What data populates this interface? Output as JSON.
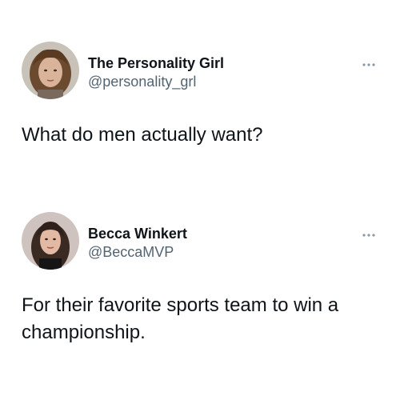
{
  "tweets": [
    {
      "display_name": "The Personality Girl",
      "handle": "@personality_grl",
      "text": "What do men actually want?",
      "more_icon": "more-horizontal-icon"
    },
    {
      "display_name": "Becca Winkert",
      "handle": "@BeccaMVP",
      "text": "For their favorite sports team to win a championship.",
      "more_icon": "more-horizontal-icon"
    }
  ],
  "colors": {
    "text": "#0f1419",
    "secondary": "#536471",
    "icon": "#8b98a5",
    "background": "#ffffff"
  }
}
